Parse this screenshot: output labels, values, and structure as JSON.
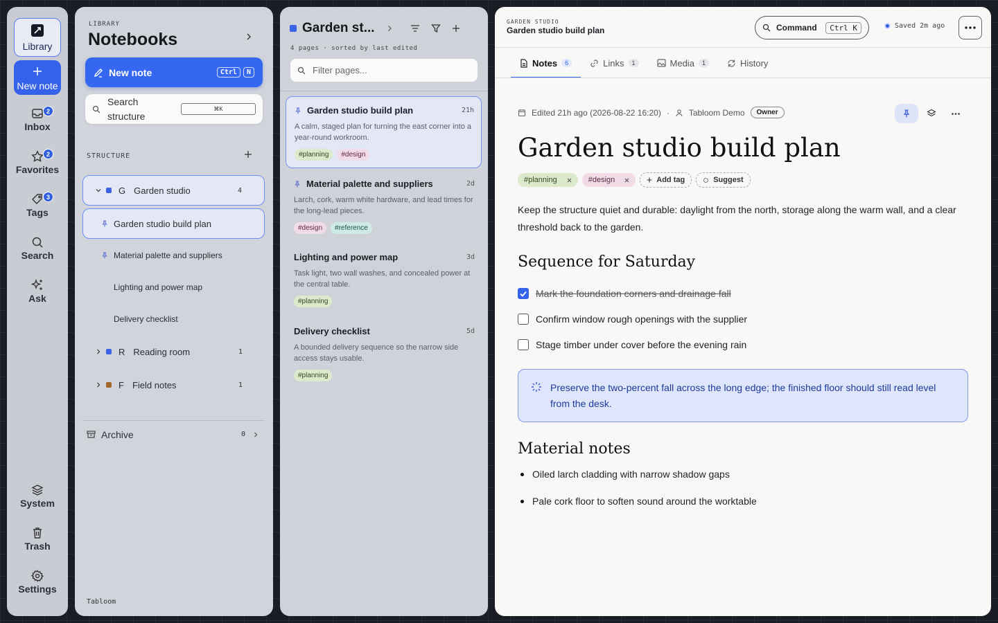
{
  "rail": {
    "library": "Library",
    "new_note": "New note",
    "items": [
      {
        "label": "Inbox",
        "badge": "2"
      },
      {
        "label": "Favorites",
        "badge": "2"
      },
      {
        "label": "Tags",
        "badge": "3"
      },
      {
        "label": "Search"
      },
      {
        "label": "Ask"
      },
      {
        "label": "System"
      },
      {
        "label": "Trash"
      },
      {
        "label": "Settings"
      }
    ]
  },
  "notebooks": {
    "kicker": "LIBRARY",
    "title": "Notebooks",
    "new_note": "New note",
    "new_note_kbd": [
      "Ctrl",
      "N"
    ],
    "search_label": "Search structure",
    "search_kbd": "⌘K",
    "structure_label": "STRUCTURE",
    "tree": [
      {
        "initial": "G",
        "label": "Garden studio",
        "count": "4",
        "color": "#3a63e6"
      },
      {
        "label": "Garden studio build plan",
        "pinned": true
      },
      {
        "label": "Material palette and suppliers",
        "pinned": true
      },
      {
        "label": "Lighting and power map"
      },
      {
        "label": "Delivery checklist"
      },
      {
        "initial": "R",
        "label": "Reading room",
        "count": "1",
        "color": "#3a63e6"
      },
      {
        "initial": "F",
        "label": "Field notes",
        "count": "1",
        "color": "#a0662a"
      }
    ],
    "archive": "Archive",
    "archive_count": "0",
    "footer": "Tabloom"
  },
  "pages": {
    "title": "Garden st...",
    "subtitle": "4 pages · sorted by last edited",
    "filter_placeholder": "Filter pages...",
    "items": [
      {
        "title": "Garden studio build plan",
        "age": "21h",
        "desc": "A calm, staged plan for turning the east corner into a year-round workroom.",
        "tags": [
          "#planning",
          "#design"
        ]
      },
      {
        "title": "Material palette and suppliers",
        "age": "2d",
        "desc": "Larch, cork, warm white hardware, and lead times for the long-lead pieces.",
        "tags": [
          "#design",
          "#reference"
        ]
      },
      {
        "title": "Lighting and power map",
        "age": "3d",
        "desc": "Task light, two wall washes, and concealed power at the central table.",
        "tags": [
          "#planning"
        ]
      },
      {
        "title": "Delivery checklist",
        "age": "5d",
        "desc": "A bounded delivery sequence so the narrow side access stays usable.",
        "tags": [
          "#planning"
        ]
      }
    ]
  },
  "main": {
    "kicker": "GARDEN STUDIO",
    "crumb": "Garden studio build plan",
    "command": "Command",
    "command_kbd": "Ctrl K",
    "saved": "Saved 2m ago",
    "tabs": [
      {
        "label": "Notes",
        "count": "6"
      },
      {
        "label": "Links",
        "count": "1"
      },
      {
        "label": "Media",
        "count": "1"
      },
      {
        "label": "History"
      }
    ],
    "edited": "Edited 21h ago (2026-08-22 16:20)",
    "sep": "·",
    "author": "Tabloom Demo",
    "role": "Owner",
    "title": "Garden studio build plan",
    "tags": [
      "#planning",
      "#design"
    ],
    "add_tag": "Add tag",
    "suggest": "Suggest",
    "intro": "Keep the structure quiet and durable: daylight from the north, storage along the warm wall, and a clear threshold back to the garden.",
    "h_sequence": "Sequence for Saturday",
    "checks": [
      {
        "text": "Mark the foundation corners and drainage fall",
        "done": true
      },
      {
        "text": "Confirm window rough openings with the supplier",
        "done": false
      },
      {
        "text": "Stage timber under cover before the evening rain",
        "done": false
      }
    ],
    "callout": "Preserve the two-percent fall across the long edge; the finished floor should still read level from the desk.",
    "h_material": "Material notes",
    "bullets": [
      "Oiled larch cladding with narrow shadow gaps",
      "Pale cork floor to soften sound around the worktable"
    ]
  },
  "colors": {
    "accent": "#3462ea",
    "planning": "#dde9cc",
    "design": "#f0dbe6",
    "reference": "#cfeae6"
  }
}
